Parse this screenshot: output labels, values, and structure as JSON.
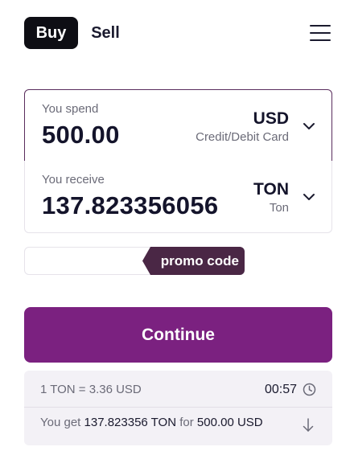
{
  "tabs": {
    "buy": "Buy",
    "sell": "Sell"
  },
  "menu_icon": "hamburger-menu-icon",
  "spend": {
    "label": "You spend",
    "amount": "500.00",
    "currency": "USD",
    "method": "Credit/Debit Card"
  },
  "receive": {
    "label": "You receive",
    "amount": "137.823356056",
    "currency": "TON",
    "currency_name": "Ton"
  },
  "promo": {
    "value": "",
    "label": "promo code"
  },
  "continue_label": "Continue",
  "quote": {
    "rate": "1 TON = 3.36 USD",
    "timer": "00:57",
    "you_get_prefix": "You get",
    "you_get_amount": "137.823356 TON",
    "you_get_for": "for",
    "you_get_price": "500.00 USD"
  },
  "colors": {
    "primary": "#7b2180",
    "promo_tag": "#4a2745",
    "active_border": "#5a2d5d",
    "dark_tab": "#0e0e14"
  }
}
